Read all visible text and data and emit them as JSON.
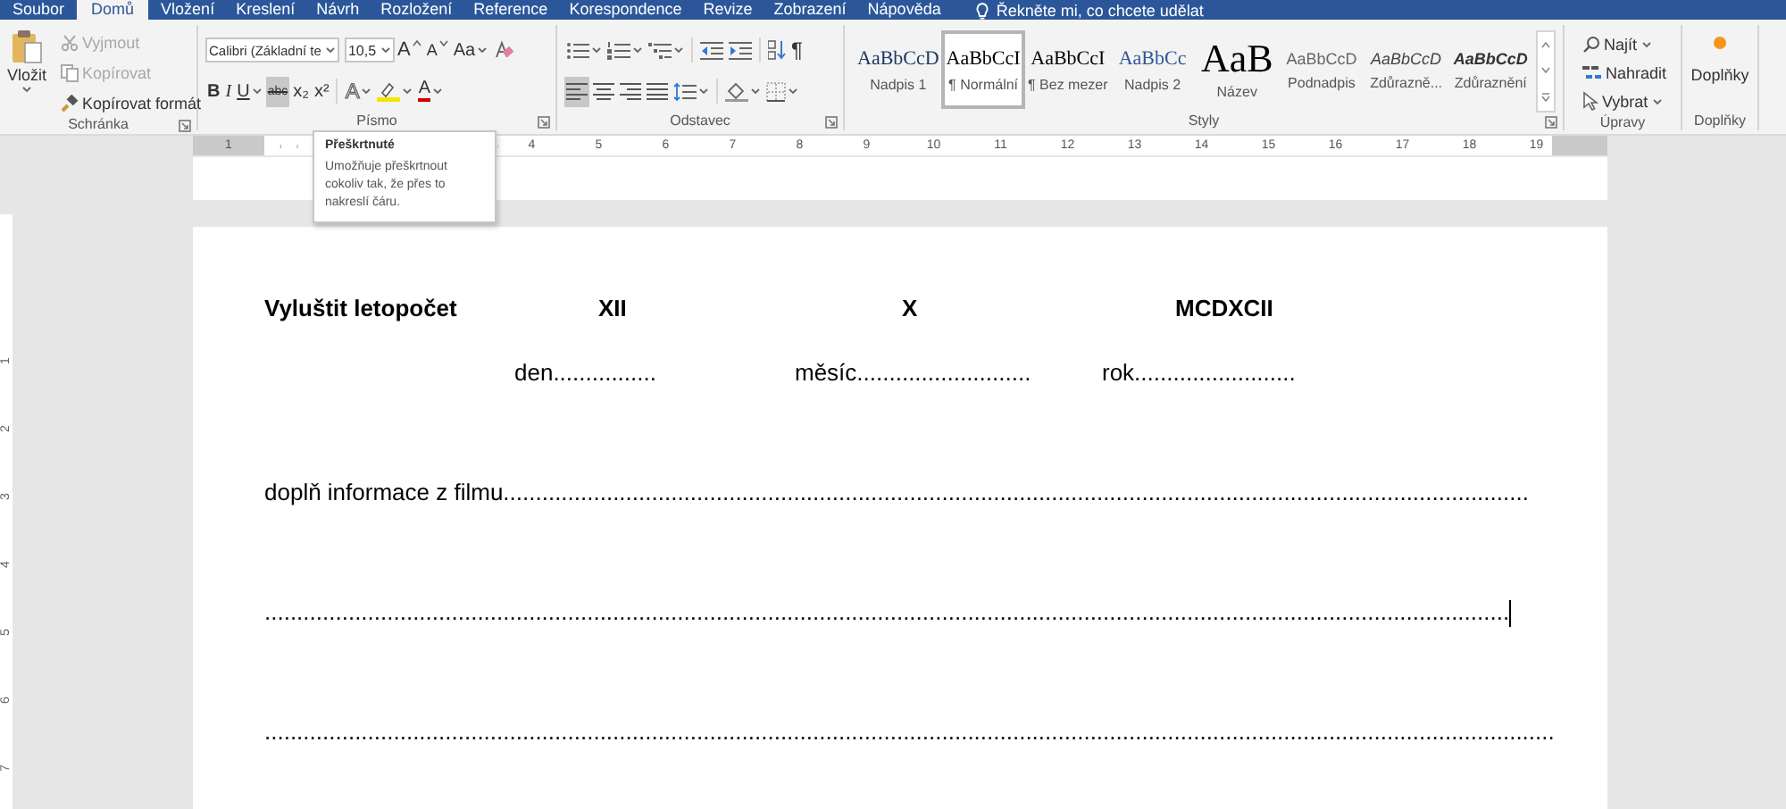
{
  "tabs": [
    {
      "label": "Soubor",
      "selected": false
    },
    {
      "label": "Domů",
      "selected": true
    },
    {
      "label": "Vložení",
      "selected": false
    },
    {
      "label": "Kreslení",
      "selected": false
    },
    {
      "label": "Návrh",
      "selected": false
    },
    {
      "label": "Rozložení",
      "selected": false
    },
    {
      "label": "Reference",
      "selected": false
    },
    {
      "label": "Korespondence",
      "selected": false
    },
    {
      "label": "Revize",
      "selected": false
    },
    {
      "label": "Zobrazení",
      "selected": false
    },
    {
      "label": "Nápověda",
      "selected": false
    }
  ],
  "tell_me": "Řekněte mi, co chcete udělat",
  "clipboard": {
    "label": "Schránka",
    "paste": "Vložit",
    "items": [
      {
        "kind": "cut",
        "label": "Vyjmout",
        "disabled": true
      },
      {
        "kind": "copy",
        "label": "Kopírovat",
        "disabled": true
      },
      {
        "kind": "format-painter",
        "label": "Kopírovat formát",
        "disabled": false
      }
    ]
  },
  "font": {
    "label": "Písmo",
    "font_name": "Calibri (Základní te",
    "font_size": "10,5",
    "tools_top": [
      {
        "kind": "grow-font",
        "label": "A",
        "selected": false
      },
      {
        "kind": "shrink-font",
        "label": "A",
        "selected": false
      },
      {
        "kind": "change-case",
        "label": "Aa",
        "selected": false
      },
      {
        "kind": "clear-formatting",
        "selected": false
      }
    ],
    "tools_bottom": [
      {
        "kind": "bold",
        "label": "B",
        "selected": false
      },
      {
        "kind": "italic",
        "label": "I",
        "selected": false
      },
      {
        "kind": "underline",
        "label": "U",
        "selected": false
      },
      {
        "kind": "strikethrough",
        "label": "abc",
        "selected": true
      },
      {
        "kind": "subscript",
        "label": "x₂",
        "selected": false
      },
      {
        "kind": "superscript",
        "label": "x²",
        "selected": false
      },
      {
        "kind": "text-effects",
        "label": "A",
        "selected": false
      },
      {
        "kind": "highlight",
        "selected": false
      },
      {
        "kind": "font-color",
        "label": "A",
        "selected": false
      }
    ]
  },
  "paragraph": {
    "label": "Odstavec",
    "tools_top": [
      {
        "kind": "bullets",
        "selected": false
      },
      {
        "kind": "numbering",
        "selected": false
      },
      {
        "kind": "multilevel-list",
        "selected": false
      },
      {
        "kind": "decrease-indent",
        "selected": false
      },
      {
        "kind": "increase-indent",
        "selected": false
      },
      {
        "kind": "sort",
        "selected": false
      },
      {
        "kind": "show-marks",
        "label": "¶",
        "selected": false
      }
    ],
    "tools_bottom": [
      {
        "kind": "align-left",
        "selected": true
      },
      {
        "kind": "align-center",
        "selected": false
      },
      {
        "kind": "align-right",
        "selected": false
      },
      {
        "kind": "justify",
        "selected": false
      },
      {
        "kind": "line-spacing",
        "selected": false
      },
      {
        "kind": "shading",
        "selected": false
      },
      {
        "kind": "borders",
        "selected": false
      }
    ]
  },
  "styles": {
    "label": "Styly",
    "items": [
      {
        "kind": "heading1",
        "preview": "AaBbCcD",
        "label": "Nadpis 1",
        "selected": false
      },
      {
        "kind": "normal",
        "preview": "AaBbCcI",
        "label": "¶ Normální",
        "selected": true
      },
      {
        "kind": "normal",
        "preview": "AaBbCcI",
        "label": "¶ Bez mezer",
        "selected": false
      },
      {
        "kind": "heading2",
        "preview": "AaBbCc",
        "label": "Nadpis 2",
        "selected": false
      },
      {
        "kind": "title",
        "preview": "AaB",
        "label": "Název",
        "selected": false
      },
      {
        "kind": "subtitle",
        "preview": "AaBbCcD",
        "label": "Podnadpis",
        "selected": false
      },
      {
        "kind": "emphasis-subtle",
        "preview": "AaBbCcD",
        "label": "Zdůrazně...",
        "selected": false
      },
      {
        "kind": "emphasis",
        "preview": "AaBbCcD",
        "label": "Zdůraznění",
        "selected": false
      }
    ]
  },
  "editing": {
    "label": "Úpravy",
    "items": [
      {
        "kind": "find",
        "label": "Najít"
      },
      {
        "kind": "replace",
        "label": "Nahradit"
      },
      {
        "kind": "select",
        "label": "Vybrat"
      }
    ]
  },
  "addins": {
    "label": "Doplňky",
    "button": "Doplňky"
  },
  "tooltip": {
    "title": "Přeškrtnuté",
    "text": "Umožňuje přeškrtnout cokoliv tak, že přes to nakreslí čáru."
  },
  "ruler": {
    "before_tooltip": [
      "1"
    ],
    "after_tooltip": [
      "4",
      "5",
      "6",
      "7",
      "8",
      "9",
      "10",
      "11",
      "12",
      "13",
      "14",
      "15",
      "16",
      "17",
      "18",
      "19"
    ]
  },
  "vertical_ruler": [
    "1",
    "2",
    "3",
    "4",
    "5",
    "6",
    "7"
  ],
  "document": [
    {
      "kind": "heading-row",
      "cells": [
        "Vyluštit letopočet",
        "XII",
        "X",
        "MCDXCII"
      ]
    },
    {
      "kind": "fields-row",
      "cells": [
        "den................",
        "měsíc...........................",
        "rok........................."
      ]
    },
    {
      "kind": "line",
      "text": "doplň informace z filmu...............................................................................................................................................................",
      "cursor": false
    },
    {
      "kind": "line",
      "text": ".................................................................................................................................................................................................",
      "cursor": true
    },
    {
      "kind": "line",
      "text": "........................................................................................................................................................................................................",
      "cursor": false
    }
  ]
}
